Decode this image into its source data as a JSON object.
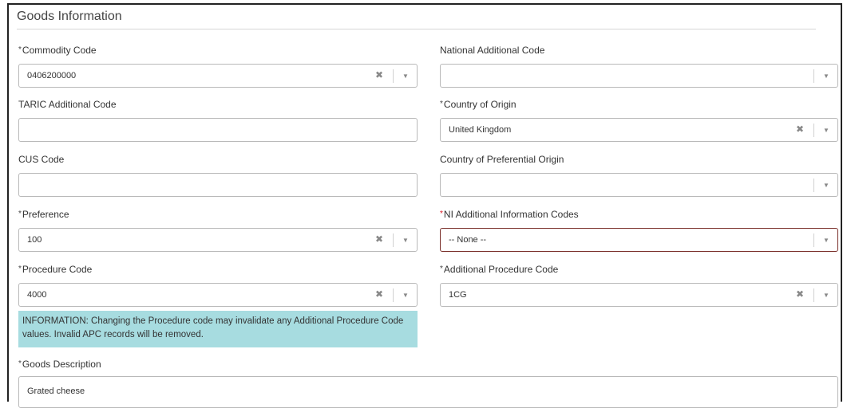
{
  "section": {
    "title": "Goods Information"
  },
  "info_message": "INFORMATION: Changing the Procedure code may invalidate any Additional Procedure Code values. Invalid APC records will be removed.",
  "fields": {
    "commodity_code": {
      "label": "Commodity Code",
      "value": "0406200000"
    },
    "national_additional_code": {
      "label": "National Additional Code",
      "value": ""
    },
    "taric_additional_code": {
      "label": "TARIC Additional Code",
      "value": ""
    },
    "country_of_origin": {
      "label": "Country of Origin",
      "value": "United Kingdom"
    },
    "cus_code": {
      "label": "CUS Code",
      "value": ""
    },
    "country_of_preferential_origin": {
      "label": "Country of Preferential Origin",
      "value": ""
    },
    "preference": {
      "label": "Preference",
      "value": "100"
    },
    "ni_additional_information_codes": {
      "label": "NI Additional Information Codes",
      "value": "-- None --"
    },
    "procedure_code": {
      "label": "Procedure Code",
      "value": "4000"
    },
    "additional_procedure_code": {
      "label": "Additional Procedure Code",
      "value": "1CG"
    },
    "goods_description": {
      "label": "Goods Description",
      "value": "Grated cheese"
    }
  },
  "glyphs": {
    "required": "*",
    "clear": "✖",
    "dropdown": "▼"
  },
  "colors": {
    "required_error": "#d9141e",
    "info_background": "#a7dce0",
    "error_border": "#7a2f2a"
  }
}
